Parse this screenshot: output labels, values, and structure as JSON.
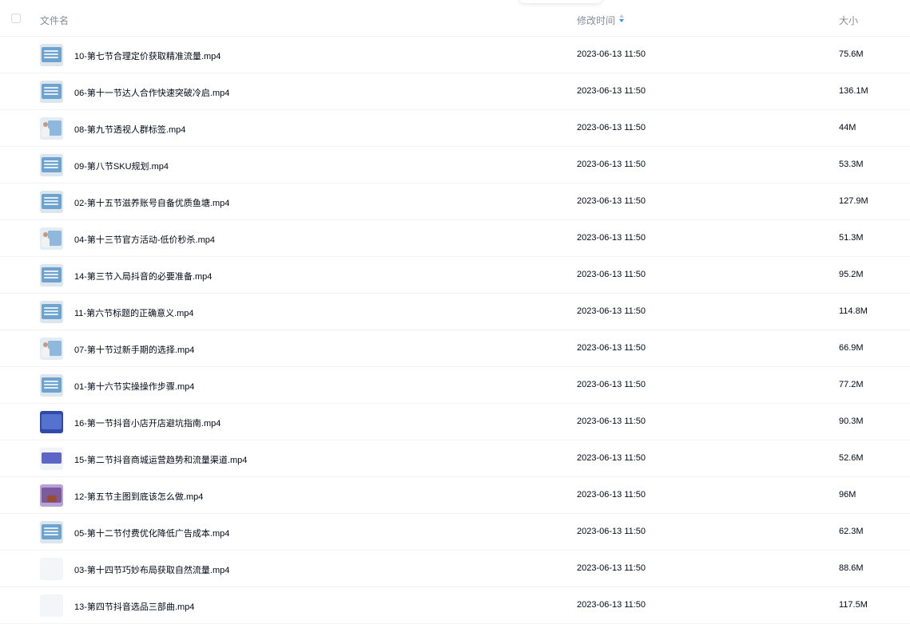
{
  "header": {
    "name_label": "文件名",
    "time_label": "修改时间",
    "size_label": "大小"
  },
  "colors": {
    "sort_active": "#3d8ff5",
    "sort_inactive": "#c5cad6"
  },
  "files": [
    {
      "name": "10-第七节合理定价获取精准流量.mp4",
      "modified": "2023-06-13 11:50",
      "size": "75.6M",
      "thumb": "screen"
    },
    {
      "name": "06-第十一节达人合作快速突破冷启.mp4",
      "modified": "2023-06-13 11:50",
      "size": "136.1M",
      "thumb": "screen"
    },
    {
      "name": "08-第九节透视人群标签.mp4",
      "modified": "2023-06-13 11:50",
      "size": "44M",
      "thumb": "person"
    },
    {
      "name": "09-第八节SKU规划.mp4",
      "modified": "2023-06-13 11:50",
      "size": "53.3M",
      "thumb": "screen"
    },
    {
      "name": "02-第十五节滋养账号自备优质鱼塘.mp4",
      "modified": "2023-06-13 11:50",
      "size": "127.9M",
      "thumb": "screen"
    },
    {
      "name": "04-第十三节官方活动-低价秒杀.mp4",
      "modified": "2023-06-13 11:50",
      "size": "51.3M",
      "thumb": "person"
    },
    {
      "name": "14-第三节入局抖音的必要准备.mp4",
      "modified": "2023-06-13 11:50",
      "size": "95.2M",
      "thumb": "screen"
    },
    {
      "name": "11-第六节标题的正确意义.mp4",
      "modified": "2023-06-13 11:50",
      "size": "114.8M",
      "thumb": "screen"
    },
    {
      "name": "07-第十节过新手期的选择.mp4",
      "modified": "2023-06-13 11:50",
      "size": "66.9M",
      "thumb": "person"
    },
    {
      "name": "01-第十六节实操操作步骤.mp4",
      "modified": "2023-06-13 11:50",
      "size": "77.2M",
      "thumb": "screen"
    },
    {
      "name": "16-第一节抖音小店开店避坑指南.mp4",
      "modified": "2023-06-13 11:50",
      "size": "90.3M",
      "thumb": "dark"
    },
    {
      "name": "15-第二节抖音商城运营趋势和流量渠道.mp4",
      "modified": "2023-06-13 11:50",
      "size": "52.6M",
      "thumb": "slide"
    },
    {
      "name": "12-第五节主图到底该怎么做.mp4",
      "modified": "2023-06-13 11:50",
      "size": "96M",
      "thumb": "product"
    },
    {
      "name": "05-第十二节付费优化降低广告成本.mp4",
      "modified": "2023-06-13 11:50",
      "size": "62.3M",
      "thumb": "screen"
    },
    {
      "name": "03-第十四节巧妙布局获取自然流量.mp4",
      "modified": "2023-06-13 11:50",
      "size": "88.6M",
      "thumb": "blank"
    },
    {
      "name": "13-第四节抖音选品三部曲.mp4",
      "modified": "2023-06-13 11:50",
      "size": "117.5M",
      "thumb": "blank"
    }
  ]
}
